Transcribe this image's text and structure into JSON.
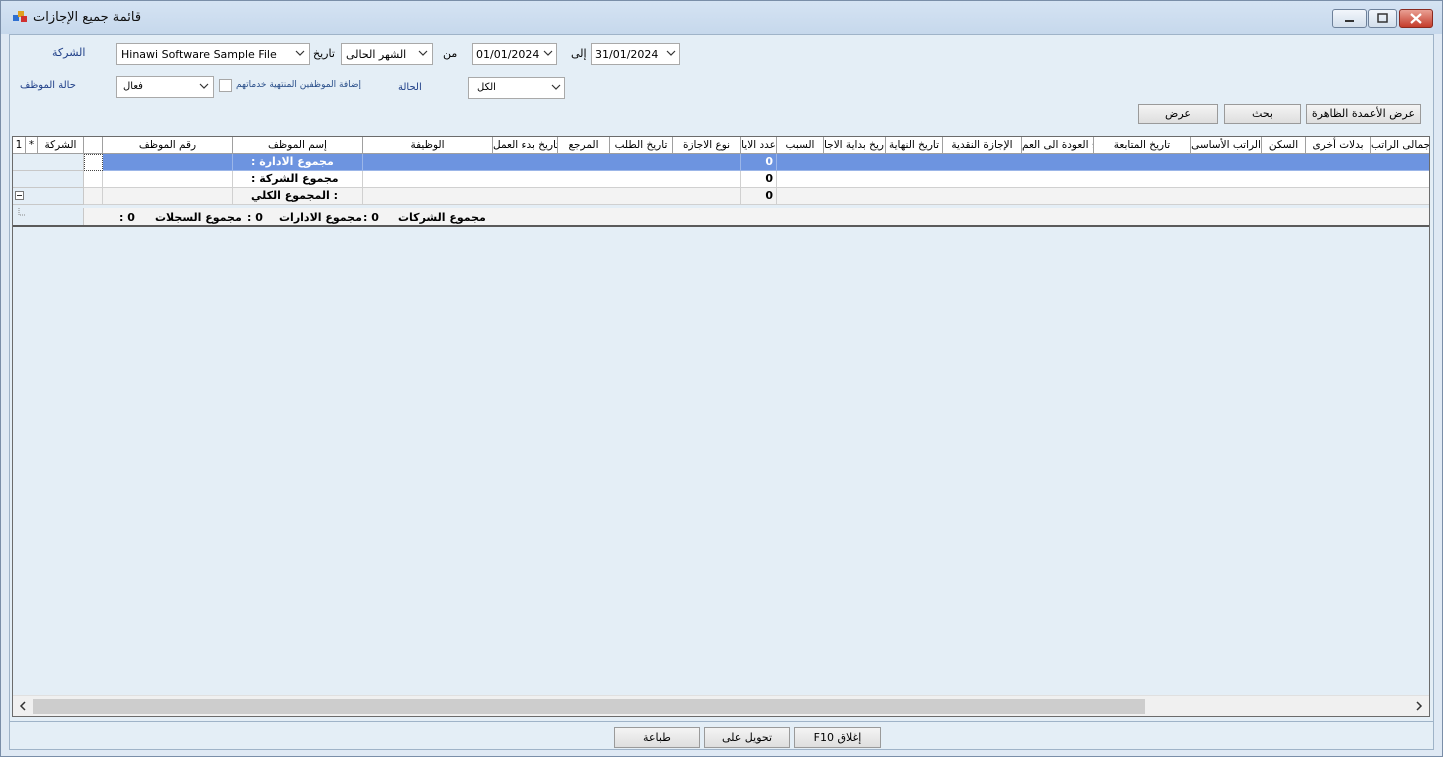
{
  "window": {
    "title": "قائمة جميع الإجازات",
    "buttons": {
      "minimize": "minimize-icon",
      "maximize": "maximize-icon",
      "close": "close-icon"
    }
  },
  "filters": {
    "company_label": "الشركة",
    "company_value": "Hinawi Software Sample File",
    "date_label": "تاريخ",
    "period_value": "الشهر الحالى",
    "from_label": "من",
    "from_date": "01/01/2024",
    "to_label": "إلى",
    "to_date": "31/01/2024",
    "employee_status_label": "حالة الموظف",
    "employee_status_value": "فعال",
    "add_terminated_label": "إضافة الموظفين المنتهية خدماتهم",
    "add_terminated_checked": false,
    "state_label": "الحالة",
    "state_value": "الكل"
  },
  "toolbar": {
    "show_visible_columns": "عرض الأعمدة الظاهرة",
    "search": "بحث",
    "show": "عرض"
  },
  "grid": {
    "row_number_header": "1",
    "star_header": "*",
    "headers": {
      "company": "الشركة",
      "emp_no": "رقم الموظف",
      "emp_name": "إسم الموظف",
      "job": "الوظيفة",
      "work_start": "تاريخ بدء العمل",
      "reference": "المرجع",
      "request_date": "تاريخ الطلب",
      "leave_type": "نوع الاجازة",
      "days": "عدد الايا",
      "reason": "السبب",
      "leave_start": "تاريخ بداية الاجا",
      "end_date": "تاريخ النهاية",
      "cash_leave": "الإجازة النقدية",
      "return_date": "تاريخ العودة الى العم",
      "follow_date": "تاريخ المتابعة",
      "basic_salary": "الراتب الأساسى",
      "housing": "السكن",
      "other_allowances": "بدلات أخرى",
      "total_salary": "إجمالى الراتب"
    },
    "rows": [
      {
        "label": "مجموع الادارة :",
        "days": "0"
      },
      {
        "label": "مجموع الشركة :",
        "days": "0"
      },
      {
        "label": ": المجموع الكلي",
        "days": "0"
      }
    ],
    "footer": {
      "companies_label": "مجموع الشركات",
      "companies_value": ": 0",
      "departments_label": "مجموع الادارات",
      "departments_value": ": 0",
      "records_label": "مجموع السجلات",
      "records_value": ": 0"
    }
  },
  "bottom": {
    "close": "F10 إغلاق",
    "transfer": "تحويل على",
    "print": "طباعة"
  }
}
